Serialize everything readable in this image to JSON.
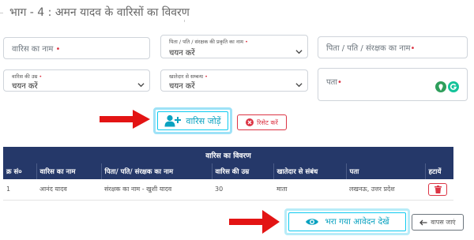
{
  "section": {
    "title": "भाग - 4 : अमन यादव के वारिसों का विवरण"
  },
  "form": {
    "heir_name": {
      "placeholder": "वारिस का नाम",
      "required": "•"
    },
    "relation_type": {
      "label": "पिता / पति / संरक्षक की प्रकृति का नाम",
      "required": "•",
      "value": "चयन करें"
    },
    "guardian_name": {
      "placeholder": "पिता / पति / संरक्षक का नाम",
      "required": "•"
    },
    "heir_age": {
      "label": "वारिस की उम्र",
      "required": "•",
      "value": "चयन करें"
    },
    "relation_with_account_holder": {
      "label": "खातेदार से सम्बन्ध",
      "required": "•",
      "value": "चयन करें"
    },
    "address": {
      "placeholder": "पता",
      "required": "•"
    }
  },
  "actions": {
    "add_heir": "वारिस जोड़ें",
    "reset": "रिसेट करें",
    "view_application": "भरा गया आवेदन देखें",
    "back": "वापस जाएं"
  },
  "table": {
    "title": "वारिस का विवरण",
    "headers": [
      "क्र सं०",
      "वारिस का नाम",
      "पिता/ पति/ संरक्षक का नाम",
      "वारिस की उम्र",
      "खातेदार से संबंध",
      "पता",
      "हटायें"
    ],
    "rows": [
      [
        "1",
        "आनंद यादव",
        "संरक्षक का नाम - खुशी यादव",
        "30",
        "माता",
        "लखनऊ, उत्तर प्रदेश"
      ]
    ]
  },
  "colors": {
    "header_bg": "#253869",
    "accent_cyan": "#0dcaf0",
    "danger": "#dc3545",
    "arrow": "#e31414"
  }
}
